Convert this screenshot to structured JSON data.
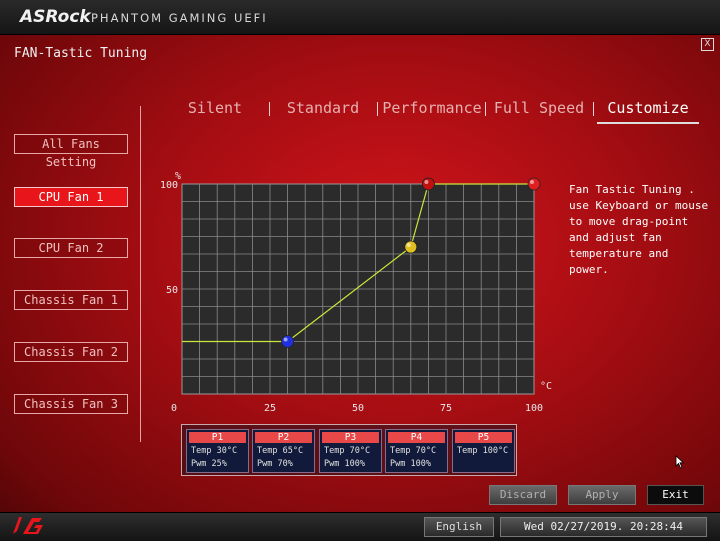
{
  "header": {
    "brand": "ASRock",
    "subtitle": "PHANTOM GAMING UEFI",
    "close_label": "X"
  },
  "page_title": "FAN-Tastic Tuning",
  "tabs": [
    {
      "label": "Silent",
      "active": false
    },
    {
      "label": "Standard",
      "active": false
    },
    {
      "label": "Performance",
      "active": false
    },
    {
      "label": "Full Speed",
      "active": false
    },
    {
      "label": "Customize",
      "active": true
    }
  ],
  "fans": [
    {
      "label": "All Fans Setting",
      "active": false
    },
    {
      "label": "CPU Fan 1",
      "active": true
    },
    {
      "label": "CPU Fan 2",
      "active": false
    },
    {
      "label": "Chassis Fan 1",
      "active": false
    },
    {
      "label": "Chassis Fan 2",
      "active": false
    },
    {
      "label": "Chassis Fan 3",
      "active": false
    }
  ],
  "description": "Fan Tastic Tuning . use Keyboard or mouse to move drag-point and adjust fan temperature and power.",
  "chart_data": {
    "type": "line",
    "ylabel": "%",
    "xlabel": "°C",
    "xlim": [
      0,
      100
    ],
    "ylim": [
      0,
      100
    ],
    "x_ticks": [
      "0",
      "25",
      "50",
      "75",
      "100"
    ],
    "y_ticks": [
      "100",
      "50"
    ],
    "grid": true,
    "line_color": "#c8e83a",
    "series": [
      {
        "name": "P1",
        "x": 30,
        "y": 25,
        "color": "#2030e0"
      },
      {
        "name": "P2",
        "x": 65,
        "y": 70,
        "color": "#e0c020"
      },
      {
        "name": "P3",
        "x": 70,
        "y": 100,
        "color": "#a040d0"
      },
      {
        "name": "P4",
        "x": 70,
        "y": 100,
        "color": "#c01010"
      },
      {
        "name": "P5",
        "x": 100,
        "y": 100,
        "color": "#e02020"
      }
    ],
    "line_points": [
      [
        0,
        25
      ],
      [
        30,
        25
      ],
      [
        65,
        70
      ],
      [
        70,
        100
      ],
      [
        100,
        100
      ]
    ]
  },
  "points": [
    {
      "name": "P1",
      "temp": "Temp 30°C",
      "pwm": "Pwm  25%"
    },
    {
      "name": "P2",
      "temp": "Temp 65°C",
      "pwm": "Pwm  70%"
    },
    {
      "name": "P3",
      "temp": "Temp 70°C",
      "pwm": "Pwm  100%"
    },
    {
      "name": "P4",
      "temp": "Temp 70°C",
      "pwm": "Pwm  100%"
    },
    {
      "name": "P5",
      "temp": "Temp 100°C",
      "pwm": ""
    }
  ],
  "actions": {
    "discard": "Discard",
    "apply": "Apply",
    "exit": "Exit"
  },
  "footer": {
    "language": "English",
    "datetime": "Wed 02/27/2019. 20:28:44"
  }
}
